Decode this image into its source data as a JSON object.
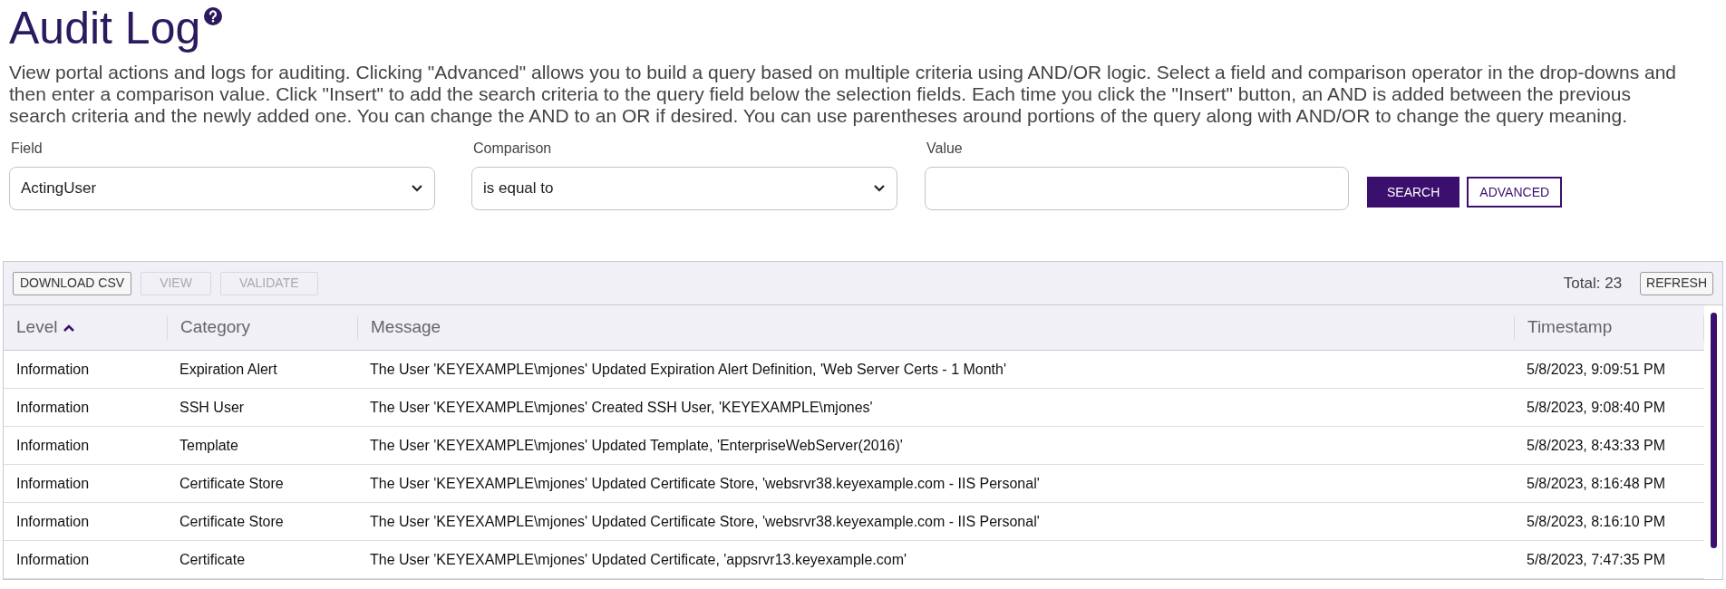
{
  "page": {
    "title": "Audit Log",
    "description": "View portal actions and logs for auditing. Clicking \"Advanced\" allows you to build a query based on multiple criteria using AND/OR logic. Select a field and comparison operator in the drop-downs and then enter a comparison value. Click \"Insert\" to add the search criteria to the query field below the selection fields. Each time you click the \"Insert\" button, an AND is added between the previous search criteria and the newly added one. You can change the AND to an OR if desired. You can use parentheses around portions of the query along with AND/OR to change the query meaning."
  },
  "filters": [
    {
      "label": "Field",
      "kind": "select",
      "value": "ActingUser"
    },
    {
      "label": "Comparison",
      "kind": "select",
      "value": "is equal to"
    },
    {
      "label": "Value",
      "kind": "input"
    }
  ],
  "actions": [
    {
      "label": "SEARCH",
      "kind": "primary"
    },
    {
      "label": "ADVANCED",
      "kind": "outline"
    }
  ],
  "toolbar": {
    "buttons": [
      {
        "label": "DOWNLOAD CSV",
        "disabled": false
      },
      {
        "label": "VIEW",
        "disabled": true
      },
      {
        "label": "VALIDATE",
        "disabled": true
      }
    ],
    "total": "Total: 23",
    "refresh": "REFRESH"
  },
  "table": {
    "columns": [
      {
        "label": "Level",
        "sorted": true
      },
      {
        "label": "Category",
        "sorted": false
      },
      {
        "label": "Message",
        "sorted": false
      },
      {
        "label": "Timestamp",
        "sorted": false
      }
    ],
    "rows": [
      [
        "Information",
        "Expiration Alert",
        "The User 'KEYEXAMPLE\\mjones' Updated Expiration Alert Definition, 'Web Server Certs - 1 Month'",
        "5/8/2023, 9:09:51 PM"
      ],
      [
        "Information",
        "SSH User",
        "The User 'KEYEXAMPLE\\mjones' Created SSH User, 'KEYEXAMPLE\\mjones'",
        "5/8/2023, 9:08:40 PM"
      ],
      [
        "Information",
        "Template",
        "The User 'KEYEXAMPLE\\mjones' Updated Template, 'EnterpriseWebServer(2016)'",
        "5/8/2023, 8:43:33 PM"
      ],
      [
        "Information",
        "Certificate Store",
        "The User 'KEYEXAMPLE\\mjones' Updated Certificate Store, 'websrvr38.keyexample.com - IIS Personal'",
        "5/8/2023, 8:16:48 PM"
      ],
      [
        "Information",
        "Certificate Store",
        "The User 'KEYEXAMPLE\\mjones' Updated Certificate Store, 'websrvr38.keyexample.com - IIS Personal'",
        "5/8/2023, 8:16:10 PM"
      ],
      [
        "Information",
        "Certificate",
        "The User 'KEYEXAMPLE\\mjones' Updated Certificate, 'appsrvr13.keyexample.com'",
        "5/8/2023, 7:47:35 PM"
      ]
    ]
  }
}
